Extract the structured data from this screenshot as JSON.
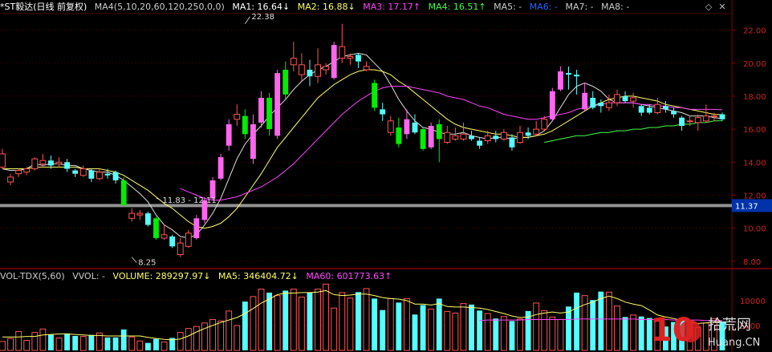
{
  "colors": {
    "up": "#ff5555",
    "up_big": "#ff66ee",
    "down": "#55ffff",
    "down_big": "#00ee00",
    "ma1": "#dddddd",
    "ma2": "#ffff66",
    "ma3": "#ff44ff",
    "ma4": "#44ff44",
    "vol_ma5": "#ffff66",
    "grid": "#8b0000",
    "axis_text": "#cc2222",
    "price_line": "#aaaaaa",
    "price_tag_bg": "#0033aa"
  },
  "header": {
    "name": "*ST毅达(日线 前复权)",
    "ma_params": "MA4(5,10,20,60,120,250,0,0)",
    "ma1": "MA1: 16.64↓",
    "ma2": "MA2: 16.88↓",
    "ma3": "MA3: 17.17↑",
    "ma4": "MA4: 16.51↑",
    "ma5": "MA5: -",
    "ma6": "MA6: -",
    "ma7": "MA7: -",
    "ma8": "MA8: -",
    "collapse_icon": "diamond-icon",
    "close_icon": "close-icon"
  },
  "volume_header": {
    "name": "VOL-TDX(5,60)",
    "vvol": "VVOL: -",
    "volume": "VOLUME: 289297.97↓",
    "ma5": "MA5: 346404.72↓",
    "ma60": "MA60: 601773.63↑"
  },
  "current_price_tag": "11.37",
  "watermark": {
    "line1": "10",
    "line2": "拾荒网",
    "line3": "Huang.CN"
  },
  "chart_data": {
    "type": "candlestick",
    "price_axis": {
      "ticks": [
        "22.00",
        "20.00",
        "18.00",
        "16.00",
        "14.00",
        "12.00",
        "10.00",
        "8.00"
      ],
      "range": [
        7.6,
        23.0
      ]
    },
    "volume_axis": {
      "ticks": [
        "10000",
        "5000"
      ],
      "range": [
        0,
        14000
      ]
    },
    "annotations": [
      {
        "text": "22.38",
        "value": 22.38,
        "index": 30
      },
      {
        "text": "8.25",
        "value": 8.25,
        "index": 16
      },
      {
        "text": "11.83 - 12.11",
        "value": 11.83,
        "index": 19
      }
    ],
    "horizontal_line": 11.37,
    "candles": [
      {
        "o": 13.7,
        "c": 14.5,
        "h": 14.8,
        "l": 13.6
      },
      {
        "o": 12.8,
        "c": 13.1,
        "h": 13.3,
        "l": 12.6
      },
      {
        "o": 13.3,
        "c": 13.5,
        "h": 13.6,
        "l": 13.1
      },
      {
        "o": 13.4,
        "c": 13.6,
        "h": 13.7,
        "l": 13.2
      },
      {
        "o": 13.6,
        "c": 14.2,
        "h": 14.3,
        "l": 13.5
      },
      {
        "o": 13.9,
        "c": 14.1,
        "h": 14.5,
        "l": 13.7
      },
      {
        "o": 14.1,
        "c": 13.8,
        "h": 14.4,
        "l": 13.6
      },
      {
        "o": 13.9,
        "c": 14.0,
        "h": 14.3,
        "l": 13.7
      },
      {
        "o": 14.0,
        "c": 13.6,
        "h": 14.2,
        "l": 13.4
      },
      {
        "o": 13.5,
        "c": 13.3,
        "h": 13.6,
        "l": 13.1
      },
      {
        "o": 13.2,
        "c": 13.6,
        "h": 13.8,
        "l": 13.1
      },
      {
        "o": 13.5,
        "c": 13.0,
        "h": 13.6,
        "l": 12.8
      },
      {
        "o": 13.0,
        "c": 13.4,
        "h": 13.6,
        "l": 12.9
      },
      {
        "o": 13.3,
        "c": 13.2,
        "h": 13.6,
        "l": 13.0
      },
      {
        "o": 13.4,
        "c": 12.9,
        "h": 13.5,
        "l": 12.7
      },
      {
        "o": 12.9,
        "c": 11.4,
        "h": 13.1,
        "l": 11.3
      },
      {
        "o": 10.6,
        "c": 10.9,
        "h": 11.2,
        "l": 10.4
      },
      {
        "o": 10.8,
        "c": 10.9,
        "h": 11.1,
        "l": 10.5
      },
      {
        "o": 10.9,
        "c": 10.2,
        "h": 11.0,
        "l": 10.1
      },
      {
        "o": 10.6,
        "c": 9.4,
        "h": 10.7,
        "l": 9.3
      },
      {
        "o": 9.4,
        "c": 9.6,
        "h": 10.2,
        "l": 9.3
      },
      {
        "o": 9.5,
        "c": 8.9,
        "h": 9.6,
        "l": 8.8
      },
      {
        "o": 8.4,
        "c": 9.1,
        "h": 9.4,
        "l": 8.25
      },
      {
        "o": 8.9,
        "c": 9.7,
        "h": 9.9,
        "l": 8.8
      },
      {
        "o": 9.4,
        "c": 10.6,
        "h": 10.8,
        "l": 9.3
      },
      {
        "o": 10.5,
        "c": 11.7,
        "h": 11.9,
        "l": 10.3
      },
      {
        "o": 11.8,
        "c": 12.9,
        "h": 13.1,
        "l": 11.7
      },
      {
        "o": 13.0,
        "c": 14.3,
        "h": 14.5,
        "l": 12.9
      },
      {
        "o": 15.0,
        "c": 16.3,
        "h": 16.6,
        "l": 14.7
      },
      {
        "o": 16.6,
        "c": 16.9,
        "h": 17.5,
        "l": 16.2
      },
      {
        "o": 16.8,
        "c": 15.7,
        "h": 17.2,
        "l": 15.4
      },
      {
        "o": 14.2,
        "c": 16.3,
        "h": 16.9,
        "l": 13.9
      },
      {
        "o": 16.4,
        "c": 17.9,
        "h": 18.3,
        "l": 16.1
      },
      {
        "o": 17.9,
        "c": 16.0,
        "h": 18.2,
        "l": 15.6
      },
      {
        "o": 15.6,
        "c": 19.4,
        "h": 19.6,
        "l": 15.4
      },
      {
        "o": 19.6,
        "c": 18.1,
        "h": 20.1,
        "l": 17.8
      },
      {
        "o": 19.9,
        "c": 20.3,
        "h": 21.3,
        "l": 19.5
      },
      {
        "o": 19.3,
        "c": 19.9,
        "h": 20.6,
        "l": 18.9
      },
      {
        "o": 19.6,
        "c": 19.2,
        "h": 20.2,
        "l": 18.6
      },
      {
        "o": 19.2,
        "c": 19.9,
        "h": 20.9,
        "l": 18.8
      },
      {
        "o": 19.6,
        "c": 19.8,
        "h": 20.0,
        "l": 19.3
      },
      {
        "o": 19.1,
        "c": 21.1,
        "h": 21.3,
        "l": 19.0
      },
      {
        "o": 20.3,
        "c": 21.0,
        "h": 22.38,
        "l": 20.0
      },
      {
        "o": 20.3,
        "c": 20.4,
        "h": 20.6,
        "l": 19.9
      },
      {
        "o": 20.5,
        "c": 20.1,
        "h": 20.6,
        "l": 19.7
      },
      {
        "o": 19.6,
        "c": 19.8,
        "h": 20.1,
        "l": 19.5
      },
      {
        "o": 18.8,
        "c": 17.3,
        "h": 19.0,
        "l": 17.1
      },
      {
        "o": 17.2,
        "c": 16.9,
        "h": 17.6,
        "l": 16.5
      },
      {
        "o": 15.8,
        "c": 16.5,
        "h": 16.8,
        "l": 15.6
      },
      {
        "o": 16.1,
        "c": 15.1,
        "h": 16.7,
        "l": 14.9
      },
      {
        "o": 15.7,
        "c": 16.6,
        "h": 17.2,
        "l": 15.4
      },
      {
        "o": 16.4,
        "c": 15.8,
        "h": 16.9,
        "l": 15.7
      },
      {
        "o": 16.0,
        "c": 14.8,
        "h": 16.1,
        "l": 14.7
      },
      {
        "o": 14.9,
        "c": 16.2,
        "h": 16.4,
        "l": 14.8
      },
      {
        "o": 16.3,
        "c": 15.4,
        "h": 16.6,
        "l": 14.0
      },
      {
        "o": 15.2,
        "c": 15.8,
        "h": 16.2,
        "l": 15.1
      },
      {
        "o": 15.4,
        "c": 15.6,
        "h": 16.1,
        "l": 15.3
      },
      {
        "o": 15.4,
        "c": 15.7,
        "h": 16.4,
        "l": 15.3
      },
      {
        "o": 15.6,
        "c": 15.4,
        "h": 15.9,
        "l": 15.3
      },
      {
        "o": 15.3,
        "c": 15.0,
        "h": 15.5,
        "l": 14.8
      },
      {
        "o": 15.3,
        "c": 15.6,
        "h": 15.9,
        "l": 15.1
      },
      {
        "o": 15.6,
        "c": 15.4,
        "h": 15.9,
        "l": 15.2
      },
      {
        "o": 15.4,
        "c": 15.8,
        "h": 16.0,
        "l": 15.3
      },
      {
        "o": 15.5,
        "c": 14.9,
        "h": 15.7,
        "l": 14.7
      },
      {
        "o": 15.2,
        "c": 15.8,
        "h": 16.2,
        "l": 15.1
      },
      {
        "o": 15.8,
        "c": 15.6,
        "h": 16.1,
        "l": 15.4
      },
      {
        "o": 15.7,
        "c": 16.0,
        "h": 16.5,
        "l": 15.6
      },
      {
        "o": 16.0,
        "c": 16.6,
        "h": 16.8,
        "l": 15.9
      },
      {
        "o": 16.6,
        "c": 18.3,
        "h": 18.5,
        "l": 16.5
      },
      {
        "o": 18.4,
        "c": 19.5,
        "h": 19.8,
        "l": 18.3
      },
      {
        "o": 19.4,
        "c": 19.3,
        "h": 19.8,
        "l": 18.4
      },
      {
        "o": 19.3,
        "c": 19.2,
        "h": 19.6,
        "l": 18.1
      },
      {
        "o": 17.2,
        "c": 18.2,
        "h": 18.8,
        "l": 17.1
      },
      {
        "o": 17.9,
        "c": 17.3,
        "h": 18.3,
        "l": 17.2
      },
      {
        "o": 17.6,
        "c": 17.4,
        "h": 17.8,
        "l": 17.0
      },
      {
        "o": 17.3,
        "c": 17.6,
        "h": 18.1,
        "l": 17.1
      },
      {
        "o": 17.6,
        "c": 18.1,
        "h": 18.4,
        "l": 17.4
      },
      {
        "o": 18.0,
        "c": 17.7,
        "h": 18.3,
        "l": 17.6
      },
      {
        "o": 17.7,
        "c": 17.9,
        "h": 18.2,
        "l": 17.3
      },
      {
        "o": 17.4,
        "c": 17.0,
        "h": 17.5,
        "l": 16.8
      },
      {
        "o": 17.3,
        "c": 17.0,
        "h": 17.5,
        "l": 16.9
      },
      {
        "o": 17.0,
        "c": 17.5,
        "h": 17.9,
        "l": 16.9
      },
      {
        "o": 17.4,
        "c": 17.2,
        "h": 17.7,
        "l": 17.0
      },
      {
        "o": 17.1,
        "c": 16.9,
        "h": 17.3,
        "l": 16.7
      },
      {
        "o": 16.7,
        "c": 16.2,
        "h": 16.8,
        "l": 15.9
      },
      {
        "o": 16.5,
        "c": 16.5,
        "h": 16.8,
        "l": 16.2
      },
      {
        "o": 16.4,
        "c": 16.7,
        "h": 16.9,
        "l": 15.9
      },
      {
        "o": 16.5,
        "c": 16.8,
        "h": 17.5,
        "l": 16.4
      },
      {
        "o": 16.8,
        "c": 16.8,
        "h": 17.0,
        "l": 16.5
      },
      {
        "o": 16.9,
        "c": 16.6,
        "h": 17.0,
        "l": 16.5
      }
    ],
    "ma_series": [
      {
        "name": "MA1",
        "values": [
          13.6,
          13.5,
          13.5,
          13.6,
          13.9,
          13.8,
          13.9,
          13.9,
          13.8,
          13.8,
          13.6,
          13.5,
          13.4,
          13.4,
          13.2,
          12.9,
          12.5,
          12.1,
          11.6,
          10.8,
          10.2,
          9.9,
          9.5,
          9.4,
          9.6,
          10.2,
          10.9,
          11.8,
          13.0,
          14.2,
          15.1,
          15.7,
          16.2,
          16.8,
          17.3,
          17.8,
          18.4,
          18.9,
          19.3,
          19.6,
          19.8,
          20.1,
          20.4,
          20.5,
          20.6,
          20.5,
          20.0,
          19.5,
          18.7,
          17.8,
          17.1,
          16.5,
          16.1,
          16.0,
          15.8,
          15.7,
          15.7,
          15.8,
          15.6,
          15.5,
          15.4,
          15.5,
          15.5,
          15.4,
          15.5,
          15.5,
          15.6,
          15.9,
          16.5,
          17.3,
          18.1,
          18.6,
          18.8,
          18.6,
          18.3,
          17.8,
          17.6,
          17.6,
          17.6,
          17.5,
          17.4,
          17.3,
          17.2,
          17.1,
          17.0,
          16.8,
          16.8,
          16.8,
          16.7,
          16.64
        ]
      },
      {
        "name": "MA2",
        "values": [
          13.6,
          13.6,
          13.6,
          13.6,
          13.7,
          13.7,
          13.7,
          13.7,
          13.7,
          13.7,
          13.6,
          13.6,
          13.6,
          13.5,
          13.4,
          13.2,
          12.9,
          12.6,
          12.3,
          11.9,
          11.5,
          11.2,
          10.8,
          10.4,
          10.1,
          10.0,
          10.1,
          10.3,
          10.7,
          11.2,
          11.9,
          12.6,
          13.3,
          14.1,
          14.9,
          15.5,
          16.1,
          16.7,
          17.3,
          17.9,
          18.3,
          18.7,
          19.0,
          19.3,
          19.5,
          19.6,
          19.6,
          19.5,
          19.3,
          18.9,
          18.6,
          18.2,
          17.8,
          17.4,
          17.0,
          16.6,
          16.3,
          16.1,
          16.0,
          15.9,
          15.8,
          15.7,
          15.7,
          15.6,
          15.5,
          15.5,
          15.6,
          15.7,
          15.9,
          16.2,
          16.5,
          16.8,
          17.1,
          17.4,
          17.6,
          17.8,
          17.9,
          18.0,
          18.0,
          17.9,
          17.8,
          17.7,
          17.5,
          17.4,
          17.3,
          17.2,
          17.1,
          17.0,
          16.9,
          16.88
        ]
      },
      {
        "name": "MA3",
        "values": [
          null,
          null,
          null,
          null,
          null,
          null,
          null,
          null,
          null,
          null,
          null,
          null,
          null,
          null,
          null,
          null,
          null,
          null,
          null,
          null,
          null,
          null,
          12.4,
          12.2,
          12.0,
          11.8,
          11.7,
          11.7,
          11.8,
          11.9,
          12.1,
          12.3,
          12.5,
          12.8,
          13.1,
          13.5,
          13.9,
          14.4,
          14.9,
          15.4,
          15.9,
          16.4,
          16.9,
          17.3,
          17.7,
          18.0,
          18.3,
          18.5,
          18.6,
          18.6,
          18.6,
          18.5,
          18.4,
          18.3,
          18.2,
          18.0,
          17.9,
          17.8,
          17.6,
          17.4,
          17.3,
          17.1,
          16.9,
          16.8,
          16.7,
          16.6,
          16.6,
          16.7,
          16.8,
          16.9,
          17.0,
          17.2,
          17.3,
          17.4,
          17.5,
          17.6,
          17.6,
          17.6,
          17.6,
          17.5,
          17.5,
          17.4,
          17.4,
          17.3,
          17.3,
          17.2,
          17.2,
          17.2,
          17.2,
          17.17
        ]
      },
      {
        "name": "MA4",
        "values": [
          null,
          null,
          null,
          null,
          null,
          null,
          null,
          null,
          null,
          null,
          null,
          null,
          null,
          null,
          null,
          null,
          null,
          null,
          null,
          null,
          null,
          null,
          null,
          null,
          null,
          null,
          null,
          null,
          null,
          null,
          null,
          null,
          null,
          null,
          null,
          null,
          null,
          null,
          null,
          null,
          null,
          null,
          null,
          null,
          null,
          null,
          null,
          null,
          null,
          null,
          null,
          null,
          null,
          null,
          null,
          null,
          null,
          null,
          null,
          null,
          null,
          null,
          null,
          null,
          null,
          null,
          null,
          15.2,
          15.3,
          15.4,
          15.5,
          15.6,
          15.6,
          15.7,
          15.8,
          15.8,
          15.9,
          15.9,
          16.0,
          16.0,
          16.1,
          16.1,
          16.2,
          16.2,
          16.3,
          16.3,
          16.4,
          16.4,
          16.5,
          16.51
        ]
      }
    ],
    "volume": {
      "values": [
        1800,
        2400,
        3800,
        2000,
        3600,
        4300,
        3200,
        2500,
        3400,
        2900,
        2800,
        3100,
        3500,
        2600,
        2600,
        4200,
        2700,
        1900,
        1500,
        2300,
        1700,
        2500,
        3600,
        4400,
        4800,
        5500,
        6200,
        5900,
        7900,
        5000,
        9800,
        10800,
        12300,
        11600,
        11000,
        12000,
        12300,
        10700,
        11600,
        12300,
        13300,
        8500,
        11600,
        10500,
        11700,
        12400,
        10400,
        8100,
        10400,
        9600,
        10400,
        7200,
        9100,
        8300,
        10400,
        7800,
        7500,
        9400,
        9200,
        8000,
        7400,
        6400,
        6800,
        5900,
        6300,
        7900,
        9500,
        8000,
        6700,
        6200,
        8800,
        11600,
        11000,
        10100,
        11800,
        11700,
        8900,
        6700,
        7100,
        6800,
        6500,
        5900,
        4800,
        5700,
        6200,
        6000,
        4600,
        5500,
        6400,
        5800
      ],
      "ma5": [
        2700,
        2700,
        2700,
        2800,
        2800,
        3100,
        3200,
        3300,
        3300,
        3200,
        3100,
        3000,
        3000,
        2900,
        2900,
        2900,
        2900,
        2900,
        2600,
        2400,
        2200,
        2100,
        2300,
        2900,
        3700,
        4400,
        5000,
        5600,
        6100,
        6600,
        7400,
        8400,
        9500,
        10300,
        11200,
        11500,
        11500,
        11600,
        11600,
        11700,
        12000,
        11200,
        11000,
        11100,
        11300,
        11300,
        11000,
        10600,
        10400,
        10300,
        10000,
        9300,
        9300,
        9100,
        9400,
        8800,
        8700,
        8700,
        8600,
        8500,
        8200,
        7800,
        7400,
        6900,
        6600,
        6700,
        7200,
        7500,
        7700,
        7500,
        7700,
        8500,
        9200,
        9700,
        10400,
        10900,
        10400,
        9700,
        9300,
        9000,
        8100,
        7100,
        6700,
        6400,
        6000,
        5700,
        5400,
        5500,
        5700,
        5800
      ],
      "ma60": [
        null,
        null,
        null,
        null,
        null,
        null,
        null,
        null,
        null,
        null,
        null,
        null,
        null,
        null,
        null,
        null,
        null,
        null,
        null,
        null,
        null,
        null,
        null,
        null,
        null,
        null,
        null,
        null,
        null,
        null,
        null,
        null,
        null,
        null,
        null,
        null,
        null,
        null,
        null,
        null,
        null,
        null,
        null,
        null,
        null,
        null,
        null,
        null,
        null,
        null,
        null,
        null,
        null,
        null,
        null,
        null,
        null,
        null,
        null,
        6000,
        6100,
        6100,
        6100,
        6100,
        6100,
        6200,
        6200,
        6200,
        6200,
        6200,
        6200,
        6300,
        6300,
        6300,
        6300,
        6300,
        6300,
        6300,
        6300,
        6200,
        6200,
        6200,
        6200,
        6100,
        6100,
        6100,
        6100,
        6000,
        6000,
        6000
      ]
    }
  }
}
